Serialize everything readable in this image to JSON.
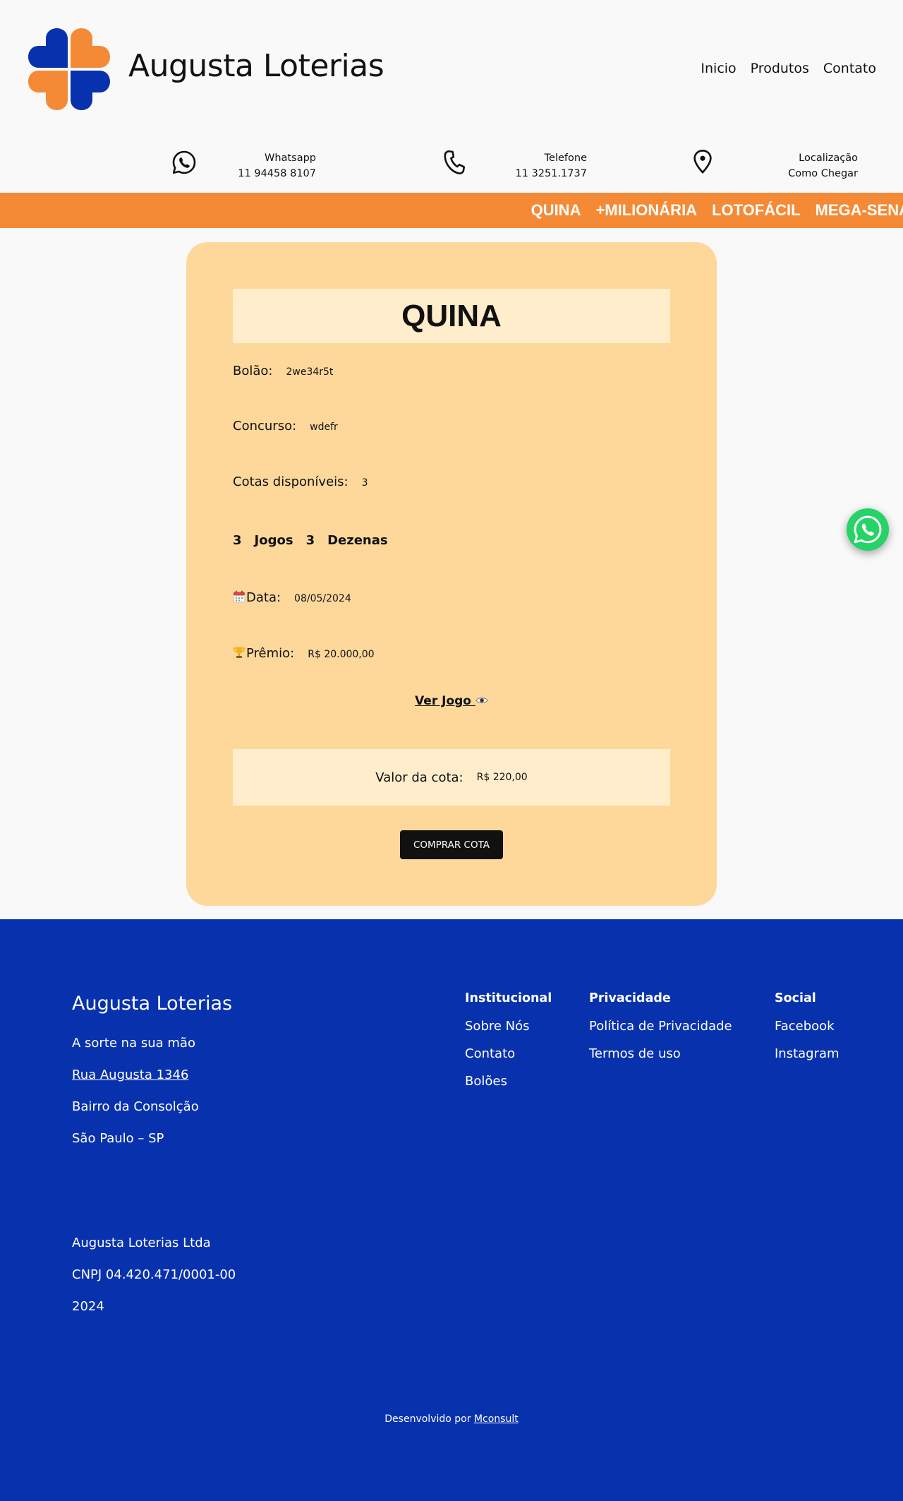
{
  "header": {
    "brand": "Augusta Loterias",
    "nav": [
      "Inicio",
      "Produtos",
      "Contato"
    ]
  },
  "contacts": {
    "whatsapp": {
      "title": "Whatsapp",
      "value": "11 94458 8107",
      "icon": "whatsapp-icon"
    },
    "phone": {
      "title": "Telefone",
      "value": "11 3251.1737",
      "icon": "phone-icon"
    },
    "location": {
      "title": "Localização",
      "value": "Como Chegar",
      "icon": "map-pin-icon"
    }
  },
  "games_bar": [
    "QUINA",
    "+MILIONÁRIA",
    "LOTOFÁCIL",
    "MEGA-SENA"
  ],
  "card": {
    "title": "QUINA",
    "bolao_label": "Bolão:",
    "bolao_value": "2we34r5t",
    "concurso_label": "Concurso:",
    "concurso_value": "wdefr",
    "cotas_label": "Cotas disponíveis:",
    "cotas_value": "3",
    "jogos_count": "3",
    "jogos_label": "Jogos",
    "dezenas_count": "3",
    "dezenas_label": "Dezenas",
    "data_label": "Data:",
    "data_value": "08/05/2024",
    "premio_label": "Prêmio:",
    "premio_value": "R$ 20.000,00",
    "ver_jogo": "Ver Jogo",
    "valor_label": "Valor da cota:",
    "valor_value": "R$ 220,00",
    "buy_button": "COMPRAR COTA"
  },
  "footer": {
    "brand": "Augusta Loterias",
    "tagline": "A sorte na sua mão",
    "address": "Rua Augusta 1346",
    "district": "Bairro da Consolção",
    "city": "São Paulo – SP",
    "company": "Augusta Loterias Ltda",
    "cnpj": "CNPJ 04.420.471/0001-00",
    "year": "2024",
    "columns": [
      {
        "title": "Institucional",
        "items": [
          "Sobre Nós",
          "Contato",
          "Bolões"
        ]
      },
      {
        "title": "Privacidade",
        "items": [
          "Política de Privacidade",
          "Termos de uso"
        ]
      },
      {
        "title": "Social",
        "items": [
          "Facebook",
          "Instagram"
        ]
      }
    ],
    "developed_by": "Desenvolvido por",
    "developer": "Mconsult"
  },
  "colors": {
    "brand_blue": "#0832ad",
    "brand_orange": "#f58a36",
    "card_bg": "#fed89b",
    "card_inner": "#ffedcc",
    "whatsapp_green": "#25d366"
  }
}
